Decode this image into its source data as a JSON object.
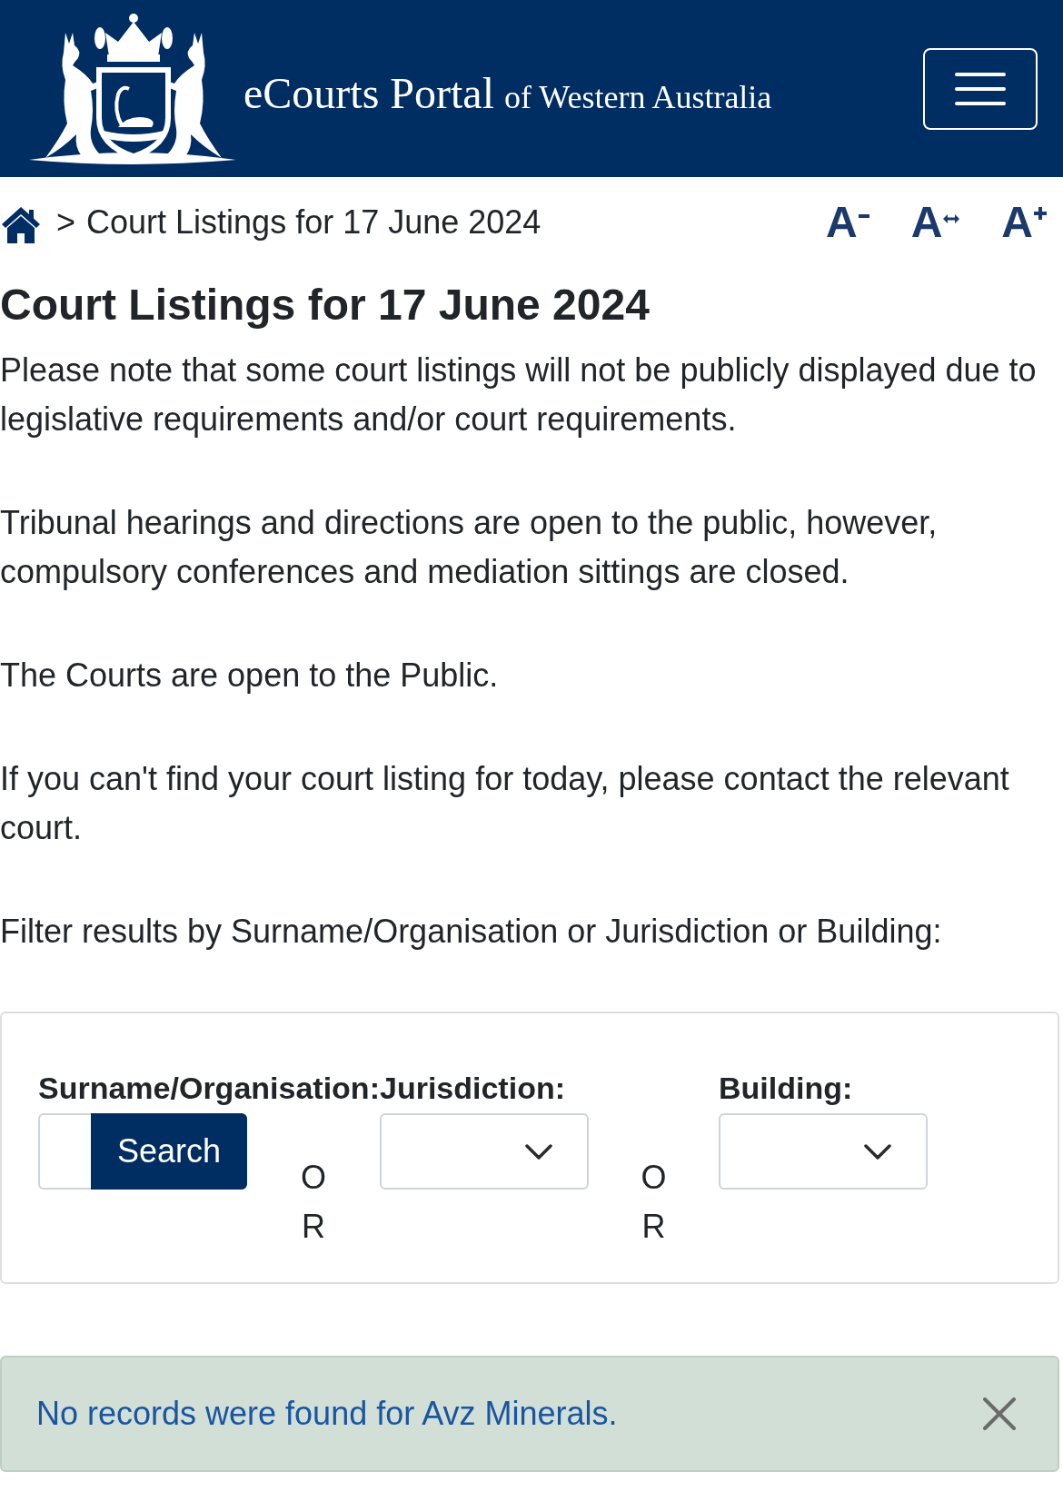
{
  "header": {
    "title": "eCourts Portal",
    "subtitle": "of Western Australia"
  },
  "breadcrumb": {
    "separator": ">",
    "current": "Court Listings for 17 June 2024"
  },
  "text_size_controls": [
    {
      "label": "A",
      "kind": "decrease"
    },
    {
      "label": "A",
      "kind": "reset"
    },
    {
      "label": "A",
      "kind": "increase"
    }
  ],
  "heading": "Court Listings for 17 June 2024",
  "paragraphs": [
    "Please note that some court listings will not be publicly displayed due to legislative requirements and/or court requirements.",
    "Tribunal hearings and directions are open to the public, however, compulsory conferences and mediation sittings are closed.",
    "The Courts are open to the Public.",
    "If you can't find your court listing for today, please contact the relevant court.",
    "Filter results by Surname/Organisation or Jurisdiction or Building:"
  ],
  "filter_form": {
    "fields": [
      {
        "kind": "search",
        "label": "Surname/Organisation:",
        "button": "Search",
        "separator": "OR"
      },
      {
        "kind": "select",
        "label": "Jurisdiction:",
        "separator": "OR"
      },
      {
        "kind": "select",
        "label": "Building:"
      }
    ]
  },
  "alert": {
    "message": "No records were found for Avz Minerals."
  }
}
